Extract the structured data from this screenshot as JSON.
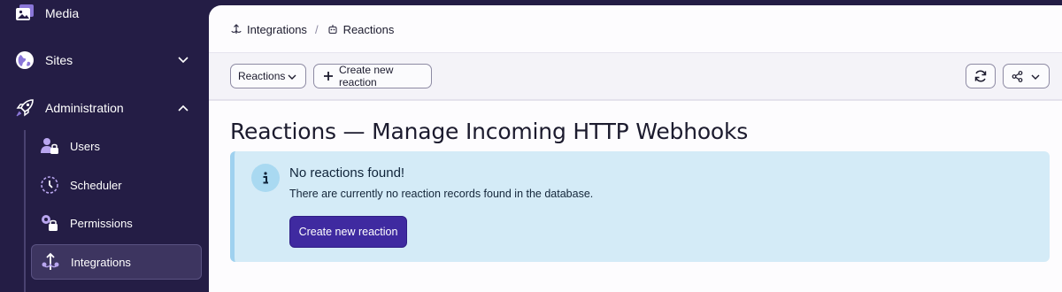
{
  "sidebar": {
    "items": [
      {
        "label": "Media",
        "icon": "media-icon"
      },
      {
        "label": "Sites",
        "icon": "globe-icon"
      },
      {
        "label": "Administration",
        "icon": "rocket-icon"
      }
    ],
    "admin_items": [
      {
        "label": "Users",
        "icon": "users-icon"
      },
      {
        "label": "Scheduler",
        "icon": "clock-icon"
      },
      {
        "label": "Permissions",
        "icon": "permissions-icon"
      },
      {
        "label": "Integrations",
        "icon": "integrations-icon",
        "active": true
      }
    ]
  },
  "breadcrumb": {
    "parent": "Integrations",
    "separator": "/",
    "current": "Reactions"
  },
  "toolbar": {
    "dropdown_label": "Reactions",
    "create_label": "Create new reaction"
  },
  "page": {
    "title": "Reactions — Manage Incoming HTTP Webhooks"
  },
  "alert": {
    "icon_glyph": "i",
    "title": "No reactions found!",
    "body": "There are currently no reaction records found in the database.",
    "button_label": "Create new reaction"
  },
  "colors": {
    "sidebar_bg": "#241d45",
    "accent_icon": "#b9a6ef",
    "primary_button": "#3f2aa0",
    "alert_bg": "#d4ebf7"
  }
}
